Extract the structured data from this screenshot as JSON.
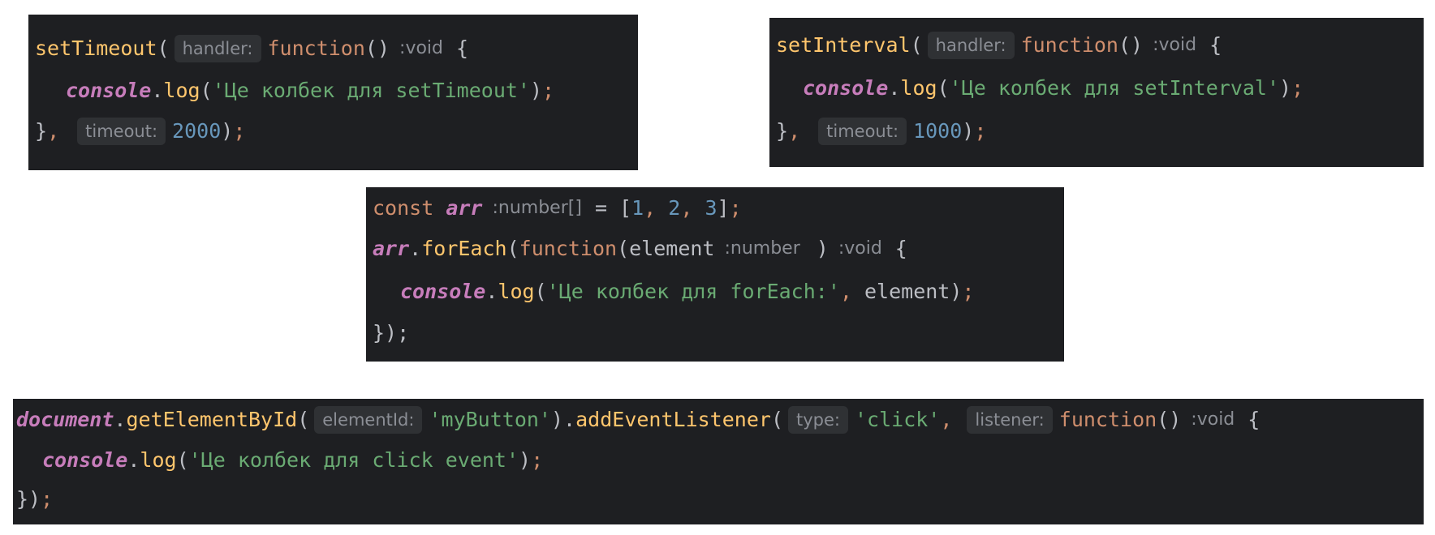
{
  "snippet_set_timeout": {
    "l1": {
      "gutter": "",
      "fn": "setTimeout",
      "open": "(",
      "hint": "handler:",
      "kw": "function",
      "parens": "()",
      "type": ":void",
      "brace": "{"
    },
    "l2": {
      "obj": "console",
      "dot": ".",
      "method": "log",
      "open": "(",
      "str": "'Це колбек для setTimeout'",
      "close": ")",
      "semi": ";"
    },
    "l3": {
      "gutter": "",
      "close": "}",
      "comma": ",",
      "hint": "timeout:",
      "num": "2000",
      "paren": ")",
      "semi": ";"
    }
  },
  "snippet_set_interval": {
    "l1": {
      "gutter": "",
      "fn": "setInterval",
      "open": "(",
      "hint": "handler:",
      "kw": "function",
      "parens": "()",
      "type": ":void",
      "brace": "{"
    },
    "l2": {
      "obj": "console",
      "dot": ".",
      "method": "log",
      "open": "(",
      "str": "'Це колбек для setInterval'",
      "close": ")",
      "semi": ";"
    },
    "l3": {
      "gutter": "",
      "close": "}",
      "comma": ",",
      "hint": "timeout:",
      "num": "1000",
      "paren": ")",
      "semi": ";"
    }
  },
  "snippet_for_each": {
    "l1": {
      "kw": "const",
      "var": "arr",
      "type": ":number[]",
      "eq": "= [",
      "n1": "1",
      "c1": ",",
      "n2": "2",
      "c2": ",",
      "n3": "3",
      "end": "]",
      "semi": ";"
    },
    "l2": {
      "gutter": "",
      "obj": "arr",
      "dot": ".",
      "fn": "forEach",
      "open": "(",
      "kw": "function",
      "param_open": "(element",
      "type_param": ":number",
      "param_close": ")",
      "type": ":void",
      "brace": "{"
    },
    "l3": {
      "obj": "console",
      "dot": ".",
      "method": "log",
      "open": "(",
      "str": "'Це колбек для forEach:'",
      "comma": ",",
      "arg": "element",
      "close": ")",
      "semi": ";"
    },
    "l4": {
      "gutter": "",
      "close": "});",
      "semi": ""
    }
  },
  "snippet_event_listener": {
    "l1": {
      "obj": "document",
      "dot": ".",
      "fn1": "getElementById",
      "open1": "(",
      "hint1": "elementId:",
      "str1": "'myButton'",
      "close1": ")",
      "dot2": ".",
      "fn2": "addEventListener",
      "open2": "(",
      "hint2": "type:",
      "str2": "'click'",
      "comma": ",",
      "hint3": "listener:",
      "kw": "function",
      "parens": "()",
      "type": ":void",
      "brace": "{"
    },
    "l2": {
      "obj": "console",
      "dot": ".",
      "method": "log",
      "open": "(",
      "str": "'Це колбек для click event'",
      "close": ")",
      "semi": ";"
    },
    "l3": {
      "close": "})",
      "semi": ";"
    }
  }
}
